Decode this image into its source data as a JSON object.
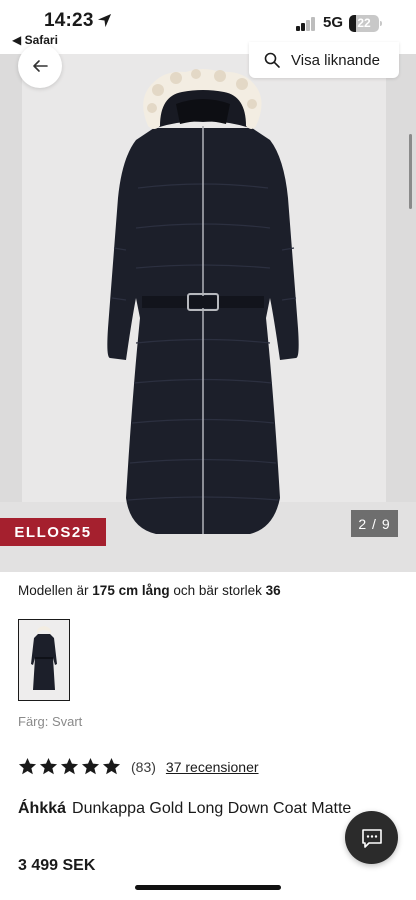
{
  "status_bar": {
    "time": "14:23",
    "back_app": "◀ Safari",
    "network": "5G",
    "battery_pct": "22",
    "battery_level": 0.22
  },
  "gallery": {
    "similar_label": "Visa liknande",
    "promo_badge": "ELLOS25",
    "image_counter": "2 / 9"
  },
  "product": {
    "model_prefix": "Modellen är ",
    "model_height": "175 cm lång",
    "model_mid": " och bär storlek ",
    "model_size": "36",
    "color_label": "Färg: Svart",
    "rating_stars": 5,
    "rating_count": "(83)",
    "reviews_link": "37 recensioner",
    "brand": "Áhkká",
    "name": "Dunkappa Gold Long Down Coat Matte",
    "price": "3 499 SEK"
  },
  "icons": {
    "back": "arrow-left-icon",
    "search": "search-icon",
    "chat": "chat-icon",
    "star": "star-icon"
  },
  "colors": {
    "promo": "#a5202e",
    "coat": "#1c1f2a",
    "fur": "#f3ede2"
  }
}
